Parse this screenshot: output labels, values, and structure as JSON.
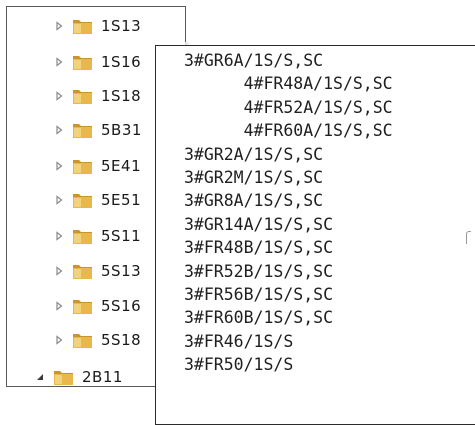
{
  "folder_tree": {
    "items": [
      {
        "label": "1S13",
        "expanded": false
      },
      {
        "label": "1S16",
        "expanded": false
      },
      {
        "label": "1S18",
        "expanded": false
      },
      {
        "label": "5B31",
        "expanded": false
      },
      {
        "label": "5E41",
        "expanded": false
      },
      {
        "label": "5E51",
        "expanded": false
      },
      {
        "label": "5S11",
        "expanded": false
      },
      {
        "label": "5S13",
        "expanded": false
      },
      {
        "label": "5S16",
        "expanded": false
      },
      {
        "label": "5S18",
        "expanded": false
      },
      {
        "label": "2B11",
        "expanded": true
      }
    ],
    "icons": {
      "collapsed": "chevron-right-icon",
      "expanded": "chevron-down-icon",
      "folder": "folder-icon"
    },
    "colors": {
      "folder": "#e8b84a",
      "folder_dark": "#c9952c",
      "arrow": "#8a8a8a"
    }
  },
  "text_panel": {
    "lines": [
      "3#GR6A/1S/S,SC",
      "      4#FR48A/1S/S,SC",
      "      4#FR52A/1S/S,SC",
      "      4#FR60A/1S/S,SC",
      "3#GR2A/1S/S,SC",
      "3#GR2M/1S/S,SC",
      "3#GR8A/1S/S,SC",
      "3#GR14A/1S/S,SC",
      "3#FR48B/1S/S,SC",
      "3#FR52B/1S/S,SC",
      "3#FR56B/1S/S,SC",
      "3#FR60B/1S/S,SC",
      "3#FR46/1S/S",
      "3#FR50/1S/S"
    ]
  }
}
